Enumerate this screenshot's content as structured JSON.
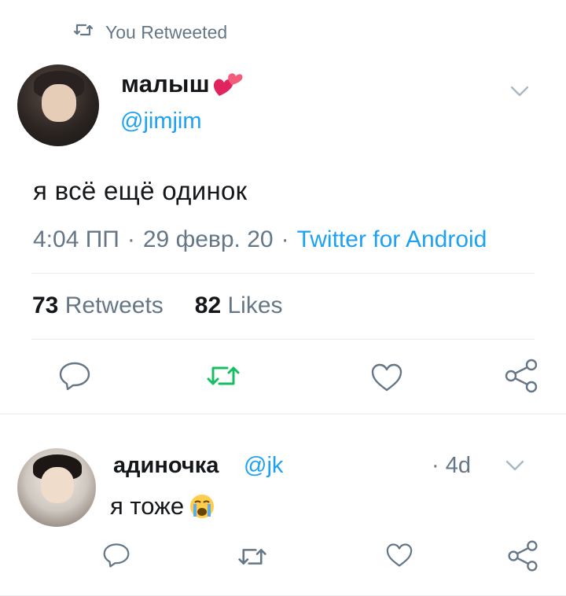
{
  "retweet_context": {
    "text": "You Retweeted"
  },
  "tweet": {
    "display_name": "малыш",
    "handle": "@jimjim",
    "text": "я всё ещё одинок",
    "time": "4:04 ПП",
    "date": "29 февр. 20",
    "separator": "·",
    "source": "Twitter for Android",
    "retweets_count": "73",
    "retweets_label": "Retweets",
    "likes_count": "82",
    "likes_label": "Likes"
  },
  "reply": {
    "display_name": "адиночка",
    "handle": "@jk",
    "time": "· 4d",
    "text": "я тоже"
  },
  "icons": {
    "retweet_context": "retweet-icon",
    "reply": "reply-icon",
    "retweet": "retweet-icon",
    "like": "heart-icon",
    "share": "share-icon",
    "caret": "chevron-down-icon",
    "name_emoji": "two-hearts-emoji",
    "reply_emoji": "loudly-crying-face-emoji"
  },
  "colors": {
    "text": "#14171a",
    "secondary": "#657786",
    "link": "#1da1f2",
    "retweeted": "#17bf63",
    "divider": "#e6ecf0"
  }
}
